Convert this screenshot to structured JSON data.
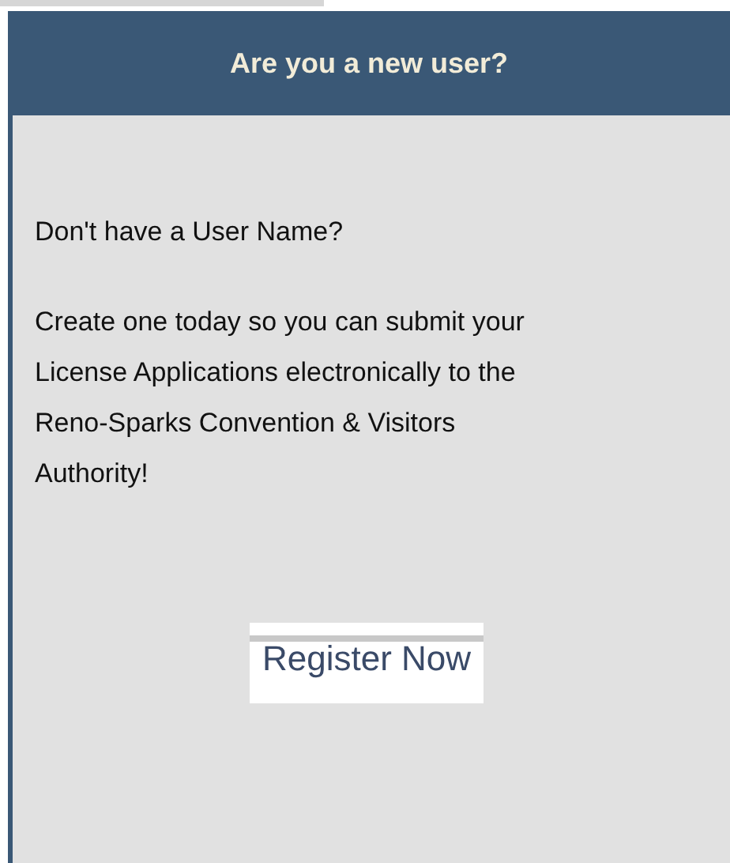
{
  "panel": {
    "title": "Are you a new user?",
    "question": "Don't have a User Name?",
    "message": "Create one today so you can submit your License Applications electronically to the Reno-Sparks Convention & Visitors Authority!",
    "button": "Register Now"
  }
}
